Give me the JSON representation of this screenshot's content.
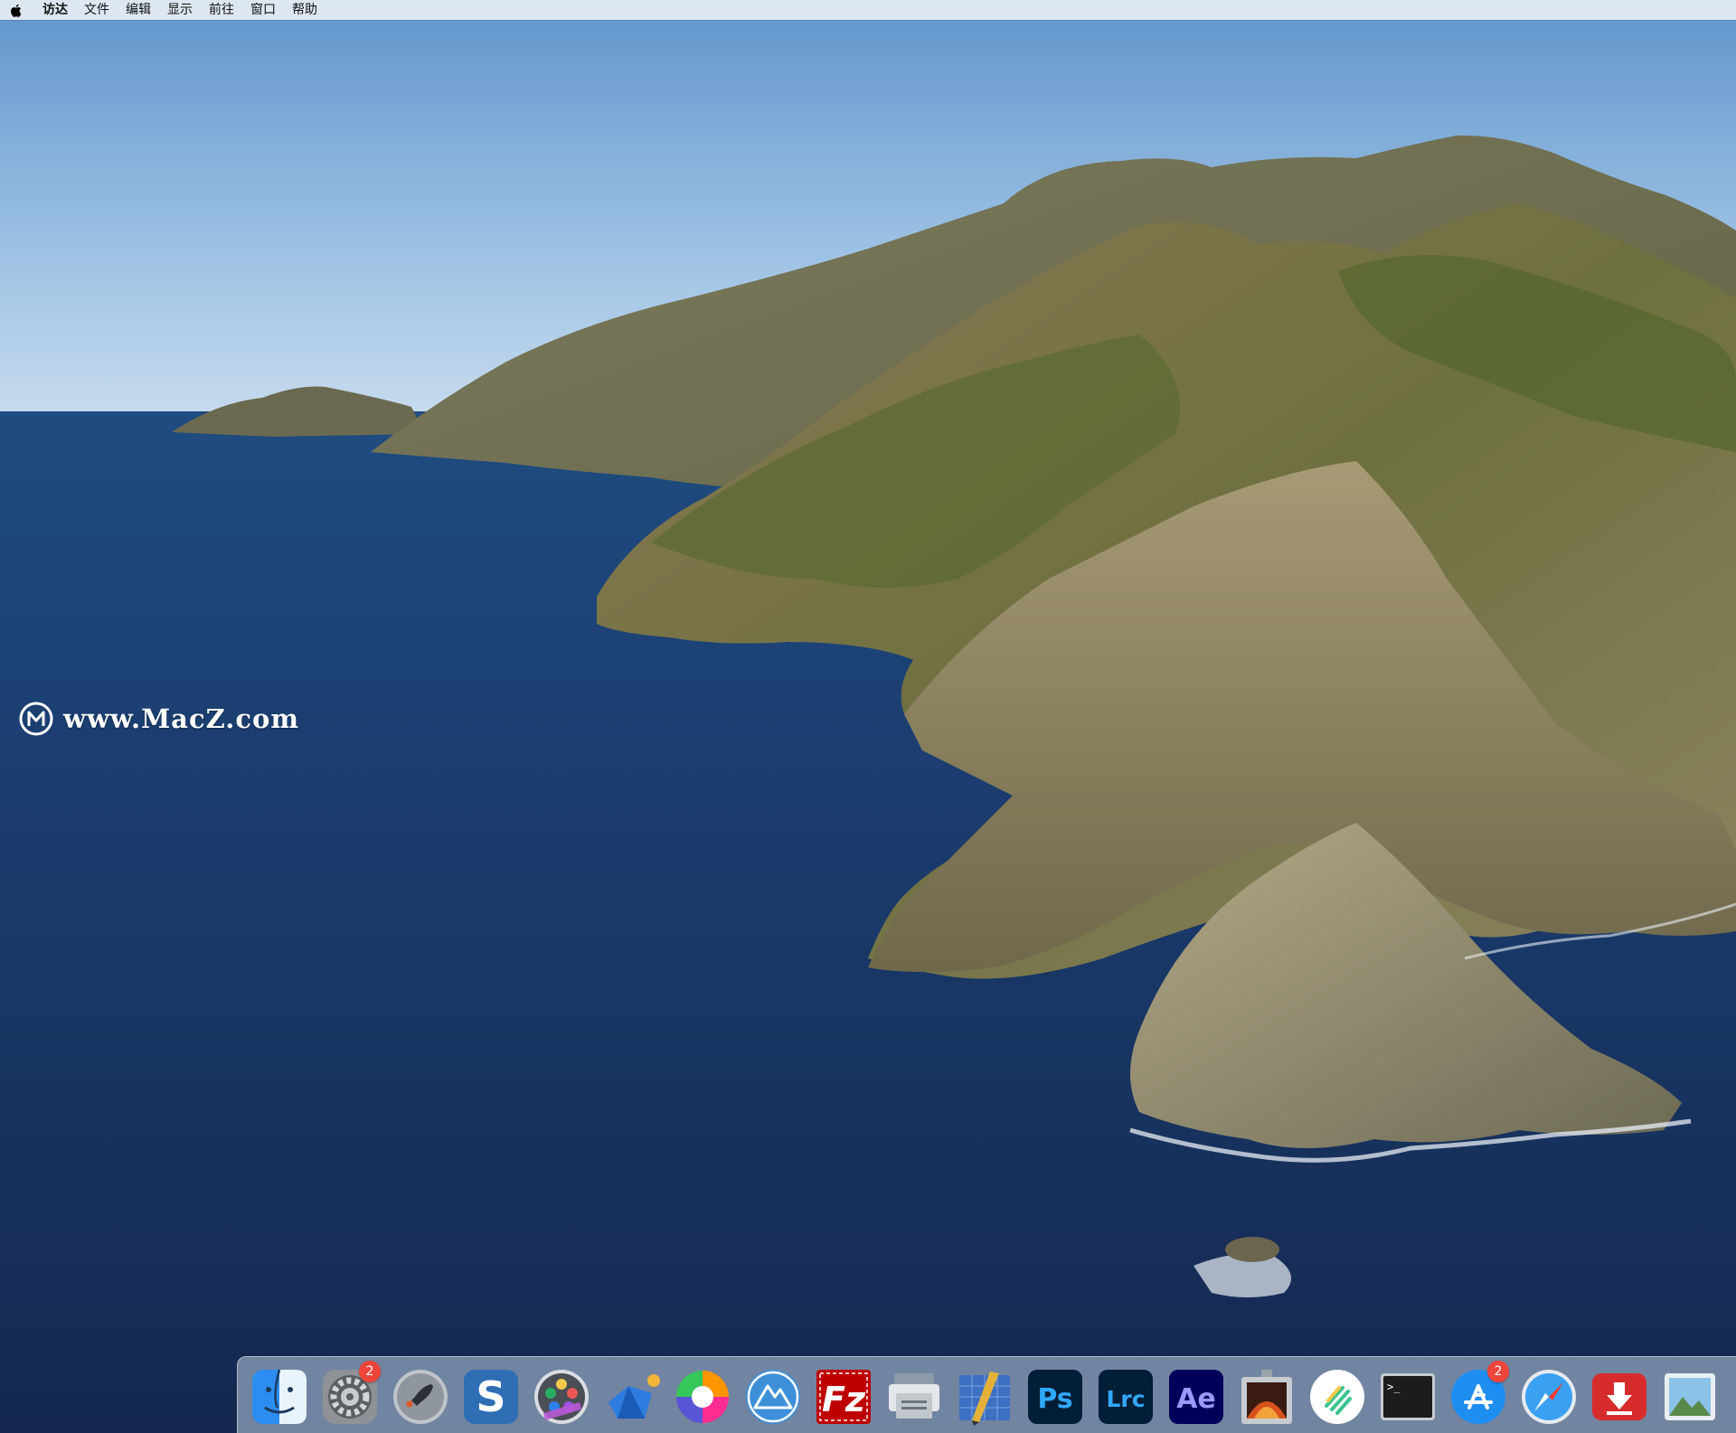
{
  "menubar": {
    "items": [
      "访达",
      "文件",
      "编辑",
      "显示",
      "前往",
      "窗口",
      "帮助"
    ]
  },
  "watermark": {
    "text": "www.MacZ.com"
  },
  "dock": {
    "apps": [
      {
        "id": "finder",
        "icon": "finder-icon"
      },
      {
        "id": "system-preferences",
        "icon": "gear-icon",
        "badge": "2"
      },
      {
        "id": "launchpad",
        "icon": "rocket-icon"
      },
      {
        "id": "scrivener",
        "icon": "s-letter-icon",
        "label": "S"
      },
      {
        "id": "motion",
        "icon": "film-reel-icon"
      },
      {
        "id": "xmind",
        "icon": "mindmap-icon"
      },
      {
        "id": "pixelmator",
        "icon": "color-wheel-icon"
      },
      {
        "id": "affinity",
        "icon": "triangle-mountain-icon"
      },
      {
        "id": "filezilla",
        "icon": "filezilla-icon",
        "label": "Fz"
      },
      {
        "id": "disk-utility",
        "icon": "disk-icon"
      },
      {
        "id": "blueprint-app",
        "icon": "blueprint-icon"
      },
      {
        "id": "photoshop",
        "icon": "photoshop-icon",
        "label": "Ps"
      },
      {
        "id": "lightroom-classic",
        "icon": "lightroom-icon",
        "label": "Lrc"
      },
      {
        "id": "after-effects",
        "icon": "after-effects-icon",
        "label": "Ae"
      },
      {
        "id": "photo-booth",
        "icon": "photo-booth-icon"
      },
      {
        "id": "notes-app",
        "icon": "lines-icon"
      },
      {
        "id": "terminal",
        "icon": "terminal-icon",
        "label": ">_"
      },
      {
        "id": "app-store",
        "icon": "app-store-icon",
        "badge": "2"
      },
      {
        "id": "safari",
        "icon": "compass-icon"
      },
      {
        "id": "downloader",
        "icon": "download-arrow-icon"
      },
      {
        "id": "preview",
        "icon": "preview-icon"
      }
    ]
  },
  "colors": {
    "sky_top": "#6d9fd1",
    "sea": "#1e3a6b",
    "ps_bg": "#001e36",
    "ps_fg": "#31a8ff",
    "lrc_bg": "#001e36",
    "lrc_fg": "#31a8ff",
    "ae_bg": "#00005b",
    "ae_fg": "#9999ff",
    "badge": "#f0453a"
  }
}
